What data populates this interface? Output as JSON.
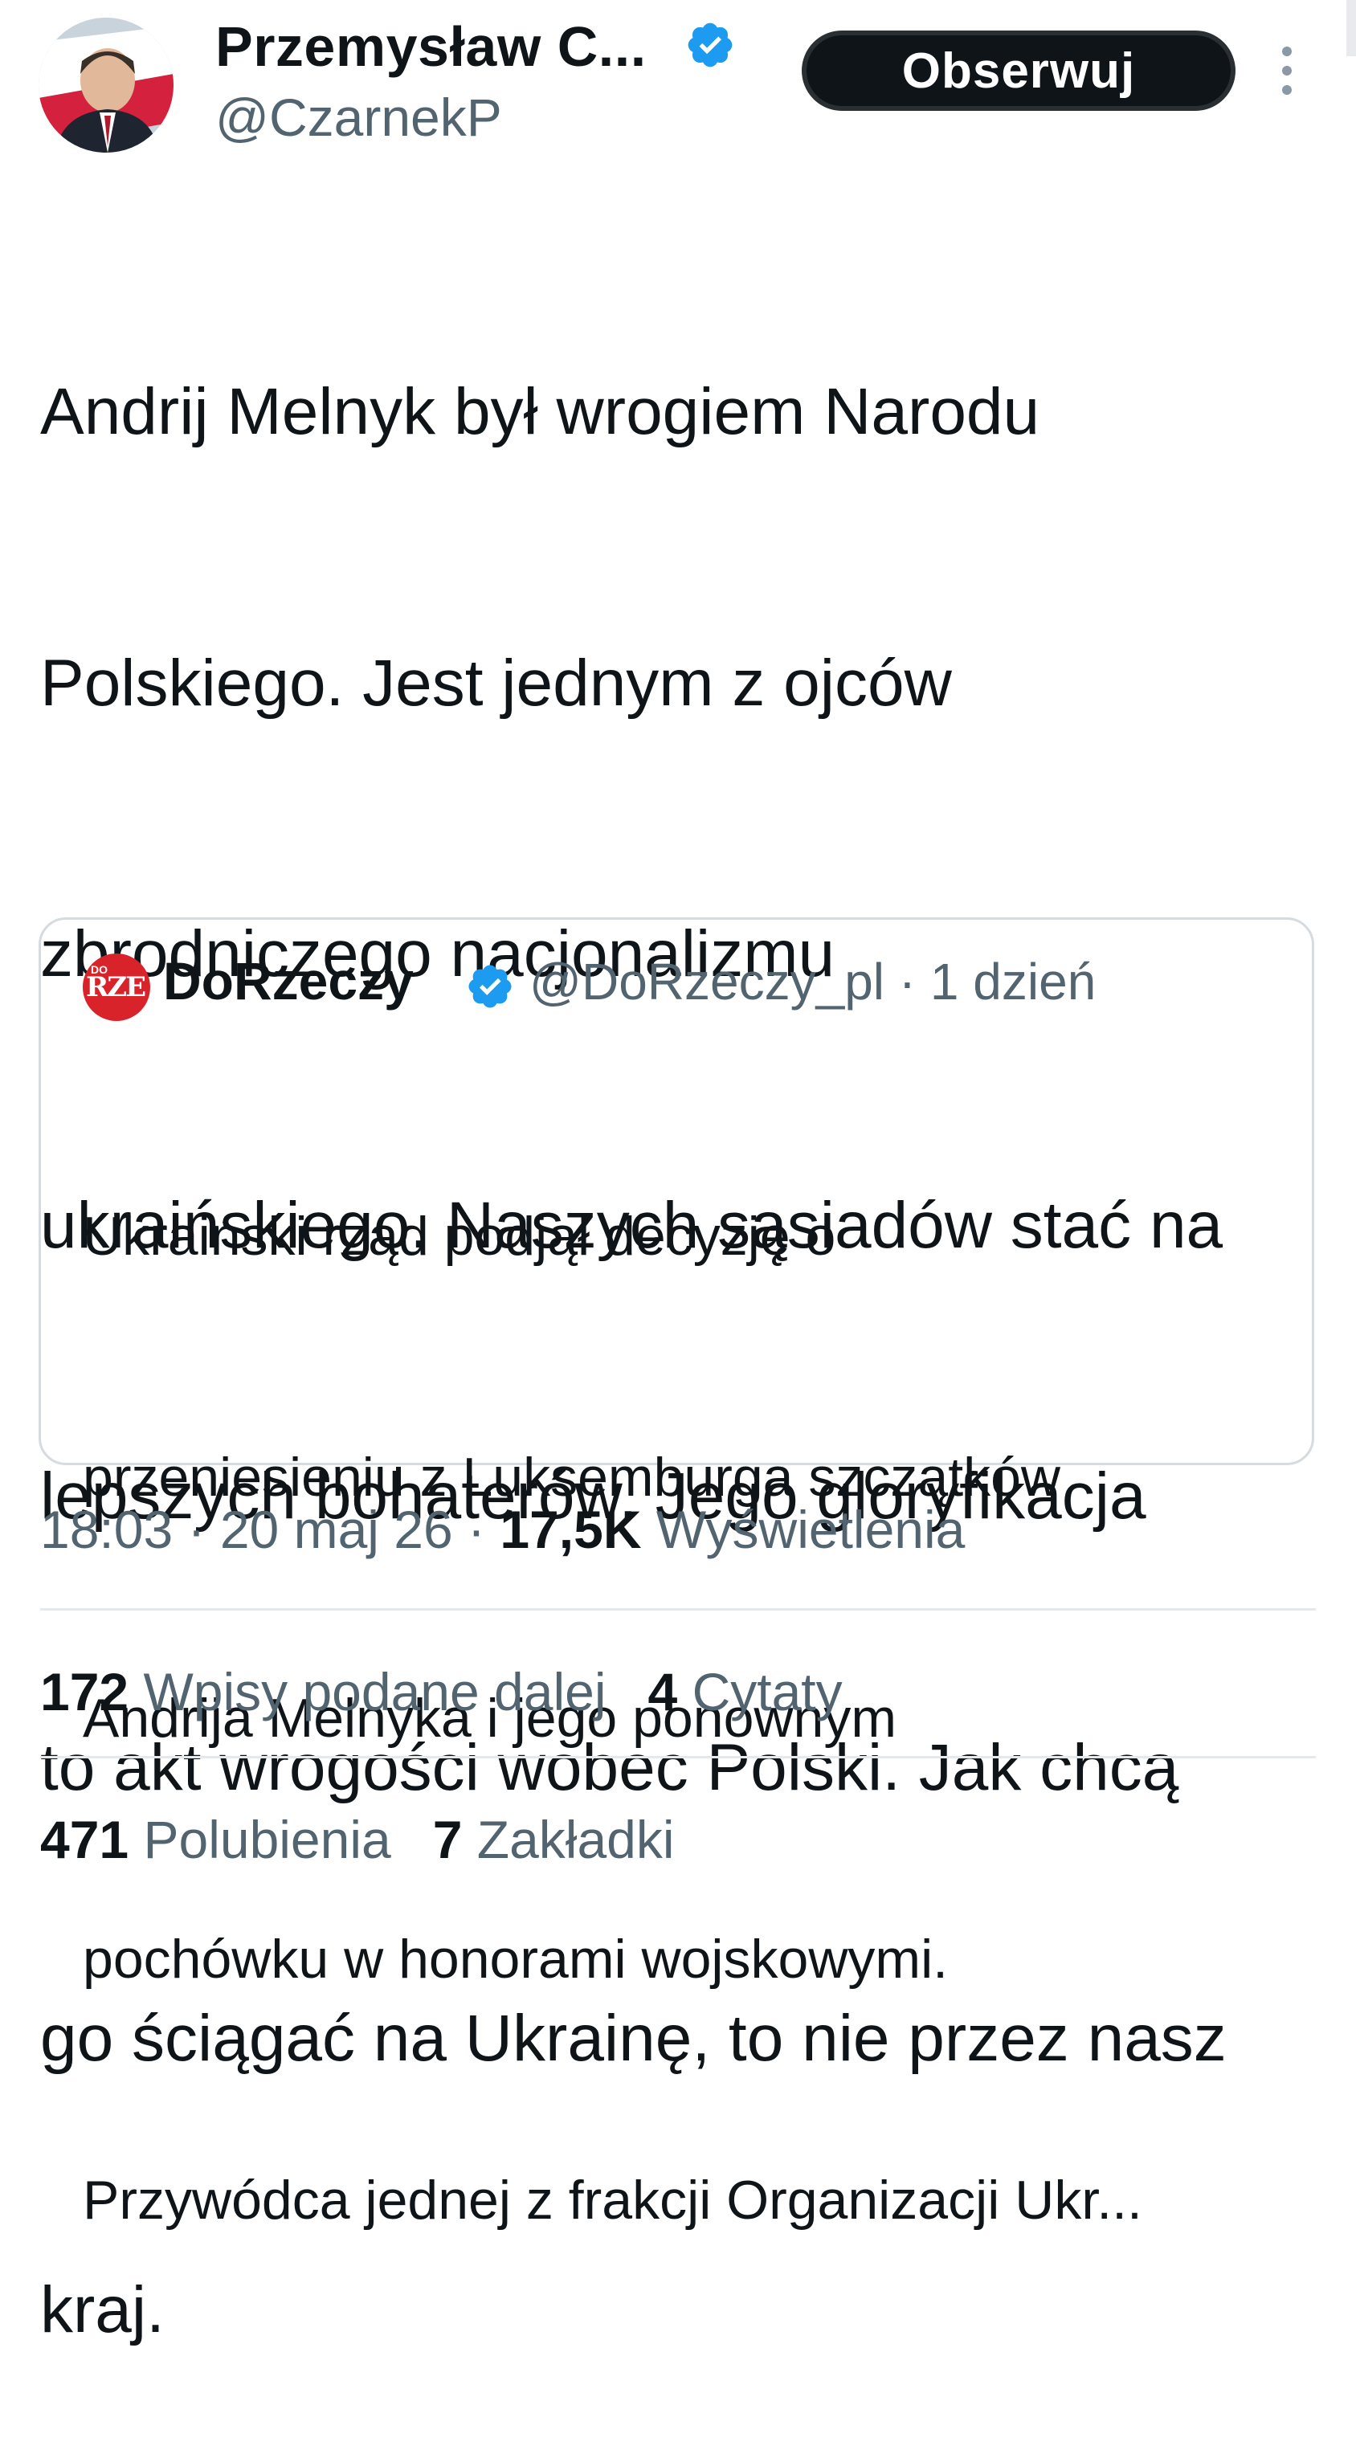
{
  "header": {
    "author_name": "Przemysław C...",
    "author_handle": "@CzarnekP",
    "follow_label": "Obserwuj",
    "verified_color": "#1d9bf0"
  },
  "tweet": {
    "lines": [
      "Andrij Melnyk był wrogiem Narodu",
      "Polskiego. Jest jednym z ojców",
      "zbrodniczego nacjonalizmu",
      "ukraińskiego. Naszych sąsiadów stać na",
      "lepszych bohaterów. Jego gloryfikacja",
      "to akt wrogości wobec Polski. Jak chcą",
      "go ściągać na Ukrainę, to nie przez nasz",
      "kraj."
    ]
  },
  "quote": {
    "avatar_text": "RZE",
    "avatar_small": "DO",
    "name": "DoRzeczy",
    "handle": "@DoRzeczy_pl",
    "separator": "·",
    "time": "1 dzień",
    "lines": [
      "Ukraiński rząd podjął decyzję o",
      "przeniesieniu z Luksemburga szczątków",
      "Andrija Melnyka i jego ponownym",
      "pochówku w honorami wojskowymi.",
      "Przywódca jednej z frakcji Organizacji Ukr..."
    ]
  },
  "meta": {
    "time": "18:03",
    "date": "20 maj 26",
    "separator": "·",
    "views_count": "17,5K",
    "views_label": "Wyświetlenia"
  },
  "stats": {
    "reposts_count": "172",
    "reposts_label": "Wpisy podane dalej",
    "quotes_count": "4",
    "quotes_label": "Cytaty",
    "likes_count": "471",
    "likes_label": "Polubienia",
    "bookmarks_count": "7",
    "bookmarks_label": "Zakładki"
  }
}
